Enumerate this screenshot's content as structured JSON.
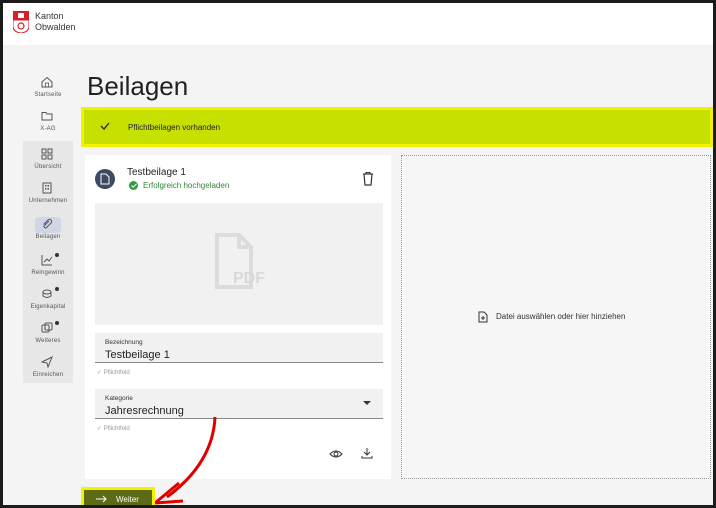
{
  "header": {
    "canton_line1": "Kanton",
    "canton_line2": "Obwalden",
    "logo_colors": {
      "shield": "#d91f26",
      "accent": "#ffffff"
    }
  },
  "sidebar": {
    "items": [
      {
        "label": "Startseite",
        "icon": "home-icon"
      },
      {
        "label": "X-AG",
        "icon": "folder-icon"
      },
      {
        "label": "Übersicht",
        "icon": "grid-icon"
      },
      {
        "label": "Unternehmen",
        "icon": "building-icon"
      },
      {
        "label": "Beilagen",
        "icon": "paperclip-icon",
        "active": true
      },
      {
        "label": "Reingewinn",
        "icon": "chart-icon",
        "dot": true
      },
      {
        "label": "Eigenkapital",
        "icon": "coins-icon",
        "dot": true
      },
      {
        "label": "Weiteres",
        "icon": "cards-icon",
        "dot": true
      },
      {
        "label": "Einreichen",
        "icon": "send-icon"
      }
    ]
  },
  "main": {
    "title": "Beilagen",
    "banner": {
      "text": "Pflichtbeilagen vorhanden",
      "color": "#c6e000"
    },
    "attachment": {
      "title": "Testbeilage 1",
      "status": "Erfolgreich hochgeladen",
      "fields": {
        "name": {
          "label": "Bezeichnung",
          "value": "Testbeilage 1",
          "hint": "Pflichtfeld"
        },
        "category": {
          "label": "Kategorie",
          "value": "Jahresrechnung",
          "hint": "Pflichtfeld"
        }
      },
      "preview_label": "PDF"
    },
    "dropzone": {
      "text": "Datei auswählen oder hier hinziehen"
    },
    "next_button": {
      "label": "Weiter"
    }
  }
}
